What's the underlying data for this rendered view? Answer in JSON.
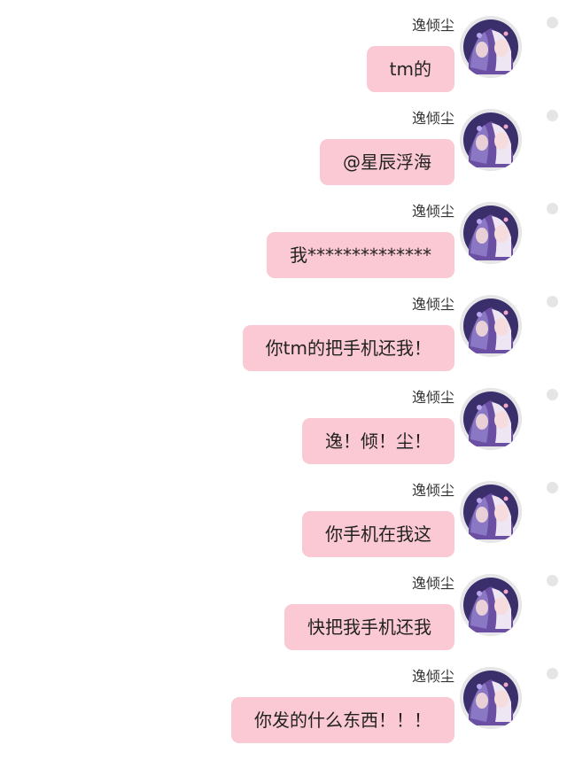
{
  "messages": [
    {
      "sender": "逸倾尘",
      "text": "tm的",
      "avatar": "anime-avatar-icon"
    },
    {
      "sender": "逸倾尘",
      "text": "@星辰浮海",
      "avatar": "anime-avatar-icon"
    },
    {
      "sender": "逸倾尘",
      "text": "我**************",
      "avatar": "anime-avatar-icon"
    },
    {
      "sender": "逸倾尘",
      "text": "你tm的把手机还我！",
      "avatar": "anime-avatar-icon"
    },
    {
      "sender": "逸倾尘",
      "text": "逸！倾！尘！",
      "avatar": "anime-avatar-icon"
    },
    {
      "sender": "逸倾尘",
      "text": "你手机在我这",
      "avatar": "anime-avatar-icon"
    },
    {
      "sender": "逸倾尘",
      "text": "快把我手机还我",
      "avatar": "anime-avatar-icon"
    },
    {
      "sender": "逸倾尘",
      "text": "你发的什么东西！！！",
      "avatar": "anime-avatar-icon"
    }
  ],
  "colors": {
    "bubble": "#fbc9d3",
    "background": "#ffffff",
    "select_dot": "#e5e5e5"
  }
}
